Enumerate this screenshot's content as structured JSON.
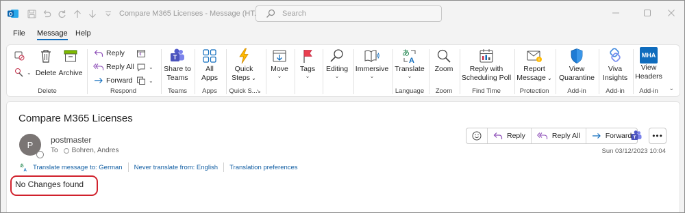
{
  "titlebar": {
    "window_title": "Compare M365 Licenses  -  Message (HT...",
    "search_placeholder": "Search"
  },
  "menu": {
    "tabs": [
      {
        "label": "File",
        "active": false
      },
      {
        "label": "Message",
        "active": true
      },
      {
        "label": "Help",
        "active": false
      }
    ]
  },
  "ribbon": {
    "groups": {
      "delete": "Delete",
      "respond": "Respond",
      "teams": "Teams",
      "apps": "Apps",
      "quick_steps": "Quick S...",
      "language": "Language",
      "zoom": "Zoom",
      "find_time": "Find Time",
      "protection": "Protection",
      "addin_1": "Add-in",
      "addin_2": "Add-in",
      "addin_3": "Add-in"
    },
    "buttons": {
      "delete": "Delete",
      "archive": "Archive",
      "reply": "Reply",
      "reply_all": "Reply All",
      "forward": "Forward",
      "share_to_teams_1": "Share to",
      "share_to_teams_2": "Teams",
      "all_apps_1": "All",
      "all_apps_2": "Apps",
      "quick_steps_1": "Quick",
      "quick_steps_2": "Steps",
      "move": "Move",
      "tags": "Tags",
      "editing": "Editing",
      "immersive": "Immersive",
      "translate": "Translate",
      "zoom": "Zoom",
      "reply_poll_1": "Reply with",
      "reply_poll_2": "Scheduling Poll",
      "report_1": "Report",
      "report_2": "Message",
      "quarantine_1": "View",
      "quarantine_2": "Quarantine",
      "viva_1": "Viva",
      "viva_2": "Insights",
      "headers_1": "View",
      "headers_2": "Headers",
      "mha_text": "MHA"
    }
  },
  "message": {
    "subject": "Compare M365 Licenses",
    "avatar_initial": "P",
    "sender": "postmaster",
    "to_label": "To",
    "recipient": "Bohren, Andres",
    "date": "Sun 03/12/2023 10:04",
    "actions": {
      "reply": "Reply",
      "reply_all": "Reply All",
      "forward": "Forward",
      "more": "•••"
    },
    "translate_bar": {
      "translate_to": "Translate message to: German",
      "never_translate": "Never translate from: English",
      "preferences": "Translation preferences"
    },
    "body": "No Changes found"
  },
  "colors": {
    "accent": "#0f6cbd",
    "highlight_border": "#d0212c",
    "avatar_bg": "#7a7574"
  }
}
